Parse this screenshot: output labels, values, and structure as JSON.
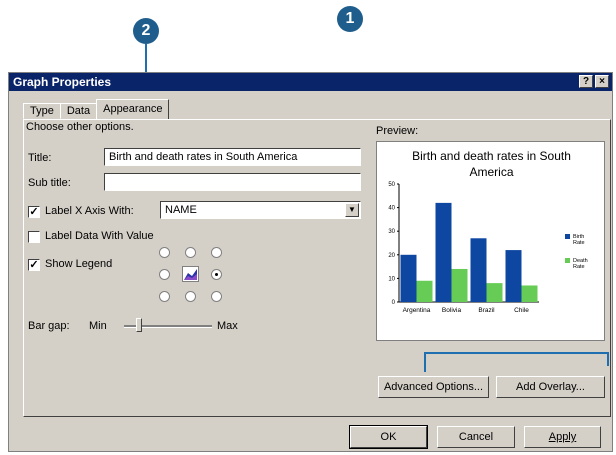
{
  "callouts": {
    "one": "1",
    "two": "2"
  },
  "window": {
    "title": "Graph Properties",
    "help_btn": "?",
    "close_btn": "×"
  },
  "tabs": [
    {
      "label": "Type"
    },
    {
      "label": "Data"
    },
    {
      "label": "Appearance"
    }
  ],
  "appearance": {
    "section_caption": "Choose other options.",
    "title_label": "Title:",
    "title_value": "Birth and death rates in South America",
    "subtitle_label": "Sub title:",
    "subtitle_value": "",
    "label_x_axis_label": "Label X Axis With:",
    "label_x_axis_value": "NAME",
    "label_x_axis_checked": true,
    "label_data_label": "Label Data With Value",
    "label_data_checked": false,
    "show_legend_label": "Show Legend",
    "show_legend_checked": true,
    "bar_gap_label": "Bar gap:",
    "bar_gap_min": "Min",
    "bar_gap_max": "Max",
    "bar_gap_level": 0.17
  },
  "preview": {
    "caption": "Preview:"
  },
  "chart_data": {
    "type": "bar",
    "title": "Birth and death rates in South America",
    "categories": [
      "Argentina",
      "Bolivia",
      "Brazil",
      "Chile"
    ],
    "series": [
      {
        "name": "Birth Rate",
        "values": [
          20,
          42,
          27,
          22
        ],
        "color": "#0d47a1"
      },
      {
        "name": "Death Rate",
        "values": [
          9,
          14,
          8,
          7
        ],
        "color": "#66cc55"
      }
    ],
    "ylim": [
      0,
      50
    ],
    "yticks": [
      "0",
      "10",
      "20",
      "30",
      "40",
      "50"
    ],
    "legend_position": "right"
  },
  "buttons": {
    "advanced": "Advanced Options...",
    "overlay": "Add Overlay...",
    "ok": "OK",
    "cancel": "Cancel",
    "apply": "Apply"
  },
  "colors": {
    "accent": "#1f6fb0",
    "titlebar": "#0a246a",
    "dialog": "#d4d0c8"
  }
}
